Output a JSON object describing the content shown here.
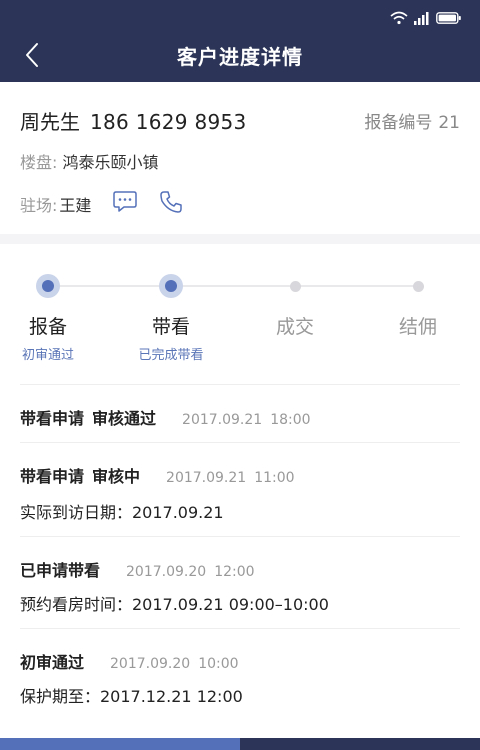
{
  "header": {
    "title": "客户进度详情"
  },
  "customer": {
    "name": "周先生",
    "phone": "186 1629 8953",
    "report_label": "报备编号",
    "report_number": "21",
    "project_label": "楼盘:",
    "project_name": "鸿泰乐颐小镇",
    "station_label": "驻场:",
    "station_name": "王建"
  },
  "progress": {
    "steps": [
      {
        "label": "报备",
        "sub": "初审通过",
        "active": true
      },
      {
        "label": "带看",
        "sub": "已完成带看",
        "active": true
      },
      {
        "label": "成交",
        "sub": "",
        "active": false
      },
      {
        "label": "结佣",
        "sub": "",
        "active": false
      }
    ]
  },
  "records": [
    {
      "type": "带看申请",
      "status": "审核通过",
      "date": "2017.09.21",
      "time": "18:00",
      "detail": ""
    },
    {
      "type": "带看申请",
      "status": "审核中",
      "date": "2017.09.21",
      "time": "11:00",
      "detail": "实际到访日期：2017.09.21"
    },
    {
      "type": "已申请带看",
      "status": "",
      "date": "2017.09.20",
      "time": "12:00",
      "detail": "预约看房时间：2017.09.21 09:00–10:00"
    },
    {
      "type": "初审通过",
      "status": "",
      "date": "2017.09.20",
      "time": "10:00",
      "detail": "保护期至：2017.12.21 12:00"
    }
  ],
  "colors": {
    "header_bg": "#2c3557",
    "accent": "#5470b8",
    "accent_light": "#c9d3e9"
  }
}
